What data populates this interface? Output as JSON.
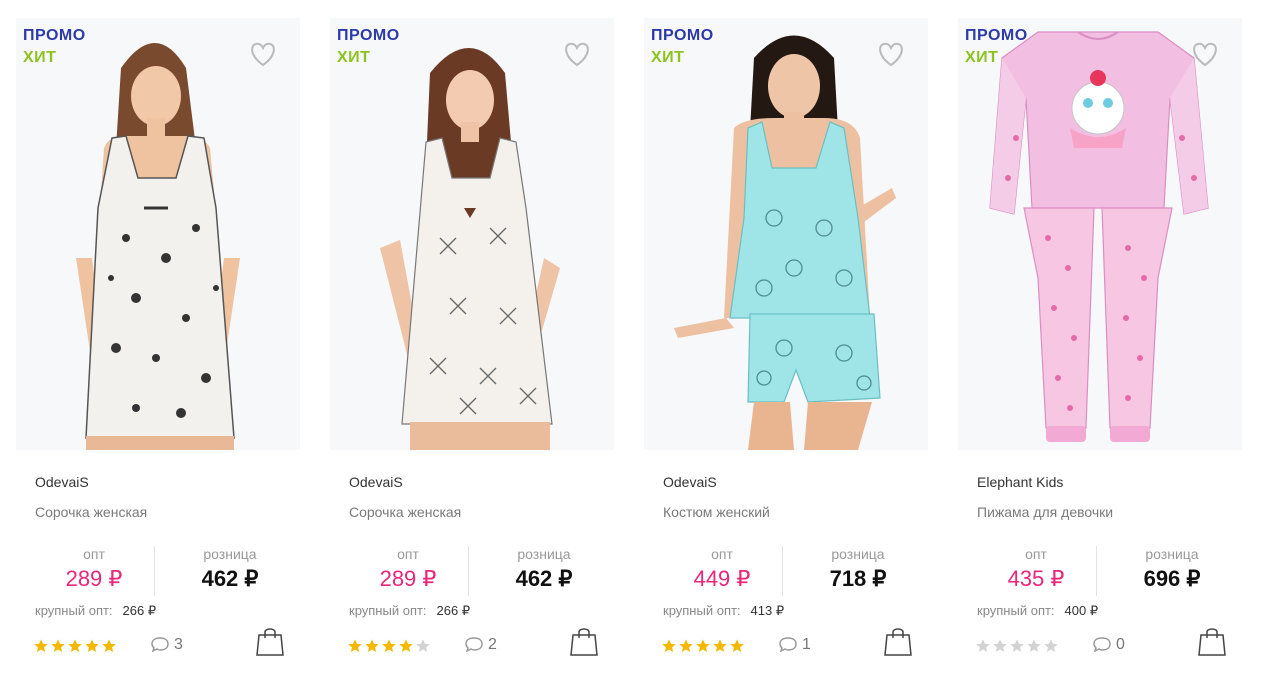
{
  "colors": {
    "promo": "#2b3aa8",
    "hit": "#8dc21f",
    "opt_price": "#e8267a",
    "star_on": "#f5b800",
    "star_off": "#d3d3d3"
  },
  "labels": {
    "opt": "опт",
    "retail": "розница",
    "bulk": "крупный опт:"
  },
  "products": [
    {
      "badges": [
        "ПРОМО",
        "ХИТ"
      ],
      "brand": "OdevaiS",
      "title": "Сорочка женская",
      "opt_price": "289 ₽",
      "retail_price": "462 ₽",
      "bulk_price": "266 ₽",
      "rating": 5,
      "comments": "3",
      "image": "woman-nightdress-white-cat-print",
      "icons": [
        "heart-icon",
        "comment-icon",
        "shopping-bag-icon"
      ]
    },
    {
      "badges": [
        "ПРОМО",
        "ХИТ"
      ],
      "brand": "OdevaiS",
      "title": "Сорочка женская",
      "opt_price": "289 ₽",
      "retail_price": "462 ₽",
      "bulk_price": "266 ₽",
      "rating": 4,
      "comments": "2",
      "image": "woman-nightdress-white-dragonfly-print",
      "icons": [
        "heart-icon",
        "comment-icon",
        "shopping-bag-icon"
      ]
    },
    {
      "badges": [
        "ПРОМО",
        "ХИТ"
      ],
      "brand": "OdevaiS",
      "title": "Костюм женский",
      "opt_price": "449 ₽",
      "retail_price": "718 ₽",
      "bulk_price": "413 ₽",
      "rating": 5,
      "comments": "1",
      "image": "woman-mint-top-and-shorts",
      "icons": [
        "heart-icon",
        "comment-icon",
        "shopping-bag-icon"
      ]
    },
    {
      "badges": [
        "ПРОМО",
        "ХИТ"
      ],
      "brand": "Elephant Kids",
      "title": "Пижама для девочки",
      "opt_price": "435 ₽",
      "retail_price": "696 ₽",
      "bulk_price": "400 ₽",
      "rating": 0,
      "comments": "0",
      "image": "girls-pink-pajama-set",
      "icons": [
        "heart-icon",
        "comment-icon",
        "shopping-bag-icon"
      ]
    }
  ]
}
